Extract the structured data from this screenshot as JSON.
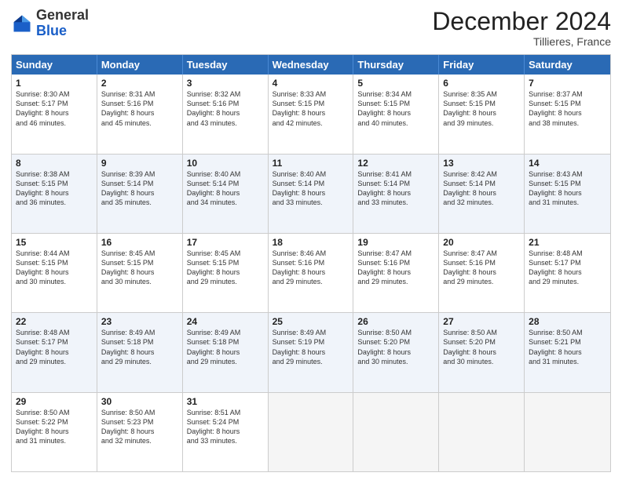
{
  "logo": {
    "general": "General",
    "blue": "Blue"
  },
  "title": "December 2024",
  "subtitle": "Tillieres, France",
  "days": [
    "Sunday",
    "Monday",
    "Tuesday",
    "Wednesday",
    "Thursday",
    "Friday",
    "Saturday"
  ],
  "rows": [
    [
      {
        "day": "1",
        "rise": "8:30 AM",
        "set": "5:17 PM",
        "daylight": "8 hours and 46 minutes."
      },
      {
        "day": "2",
        "rise": "8:31 AM",
        "set": "5:16 PM",
        "daylight": "8 hours and 45 minutes."
      },
      {
        "day": "3",
        "rise": "8:32 AM",
        "set": "5:16 PM",
        "daylight": "8 hours and 43 minutes."
      },
      {
        "day": "4",
        "rise": "8:33 AM",
        "set": "5:15 PM",
        "daylight": "8 hours and 42 minutes."
      },
      {
        "day": "5",
        "rise": "8:34 AM",
        "set": "5:15 PM",
        "daylight": "8 hours and 40 minutes."
      },
      {
        "day": "6",
        "rise": "8:35 AM",
        "set": "5:15 PM",
        "daylight": "8 hours and 39 minutes."
      },
      {
        "day": "7",
        "rise": "8:37 AM",
        "set": "5:15 PM",
        "daylight": "8 hours and 38 minutes."
      }
    ],
    [
      {
        "day": "8",
        "rise": "8:38 AM",
        "set": "5:15 PM",
        "daylight": "8 hours and 36 minutes."
      },
      {
        "day": "9",
        "rise": "8:39 AM",
        "set": "5:14 PM",
        "daylight": "8 hours and 35 minutes."
      },
      {
        "day": "10",
        "rise": "8:40 AM",
        "set": "5:14 PM",
        "daylight": "8 hours and 34 minutes."
      },
      {
        "day": "11",
        "rise": "8:40 AM",
        "set": "5:14 PM",
        "daylight": "8 hours and 33 minutes."
      },
      {
        "day": "12",
        "rise": "8:41 AM",
        "set": "5:14 PM",
        "daylight": "8 hours and 33 minutes."
      },
      {
        "day": "13",
        "rise": "8:42 AM",
        "set": "5:14 PM",
        "daylight": "8 hours and 32 minutes."
      },
      {
        "day": "14",
        "rise": "8:43 AM",
        "set": "5:15 PM",
        "daylight": "8 hours and 31 minutes."
      }
    ],
    [
      {
        "day": "15",
        "rise": "8:44 AM",
        "set": "5:15 PM",
        "daylight": "8 hours and 30 minutes."
      },
      {
        "day": "16",
        "rise": "8:45 AM",
        "set": "5:15 PM",
        "daylight": "8 hours and 30 minutes."
      },
      {
        "day": "17",
        "rise": "8:45 AM",
        "set": "5:15 PM",
        "daylight": "8 hours and 29 minutes."
      },
      {
        "day": "18",
        "rise": "8:46 AM",
        "set": "5:16 PM",
        "daylight": "8 hours and 29 minutes."
      },
      {
        "day": "19",
        "rise": "8:47 AM",
        "set": "5:16 PM",
        "daylight": "8 hours and 29 minutes."
      },
      {
        "day": "20",
        "rise": "8:47 AM",
        "set": "5:16 PM",
        "daylight": "8 hours and 29 minutes."
      },
      {
        "day": "21",
        "rise": "8:48 AM",
        "set": "5:17 PM",
        "daylight": "8 hours and 29 minutes."
      }
    ],
    [
      {
        "day": "22",
        "rise": "8:48 AM",
        "set": "5:17 PM",
        "daylight": "8 hours and 29 minutes."
      },
      {
        "day": "23",
        "rise": "8:49 AM",
        "set": "5:18 PM",
        "daylight": "8 hours and 29 minutes."
      },
      {
        "day": "24",
        "rise": "8:49 AM",
        "set": "5:18 PM",
        "daylight": "8 hours and 29 minutes."
      },
      {
        "day": "25",
        "rise": "8:49 AM",
        "set": "5:19 PM",
        "daylight": "8 hours and 29 minutes."
      },
      {
        "day": "26",
        "rise": "8:50 AM",
        "set": "5:20 PM",
        "daylight": "8 hours and 30 minutes."
      },
      {
        "day": "27",
        "rise": "8:50 AM",
        "set": "5:20 PM",
        "daylight": "8 hours and 30 minutes."
      },
      {
        "day": "28",
        "rise": "8:50 AM",
        "set": "5:21 PM",
        "daylight": "8 hours and 31 minutes."
      }
    ],
    [
      {
        "day": "29",
        "rise": "8:50 AM",
        "set": "5:22 PM",
        "daylight": "8 hours and 31 minutes."
      },
      {
        "day": "30",
        "rise": "8:50 AM",
        "set": "5:23 PM",
        "daylight": "8 hours and 32 minutes."
      },
      {
        "day": "31",
        "rise": "8:51 AM",
        "set": "5:24 PM",
        "daylight": "8 hours and 33 minutes."
      },
      null,
      null,
      null,
      null
    ]
  ],
  "labels": {
    "sunrise": "Sunrise:",
    "sunset": "Sunset:",
    "daylight": "Daylight:"
  }
}
